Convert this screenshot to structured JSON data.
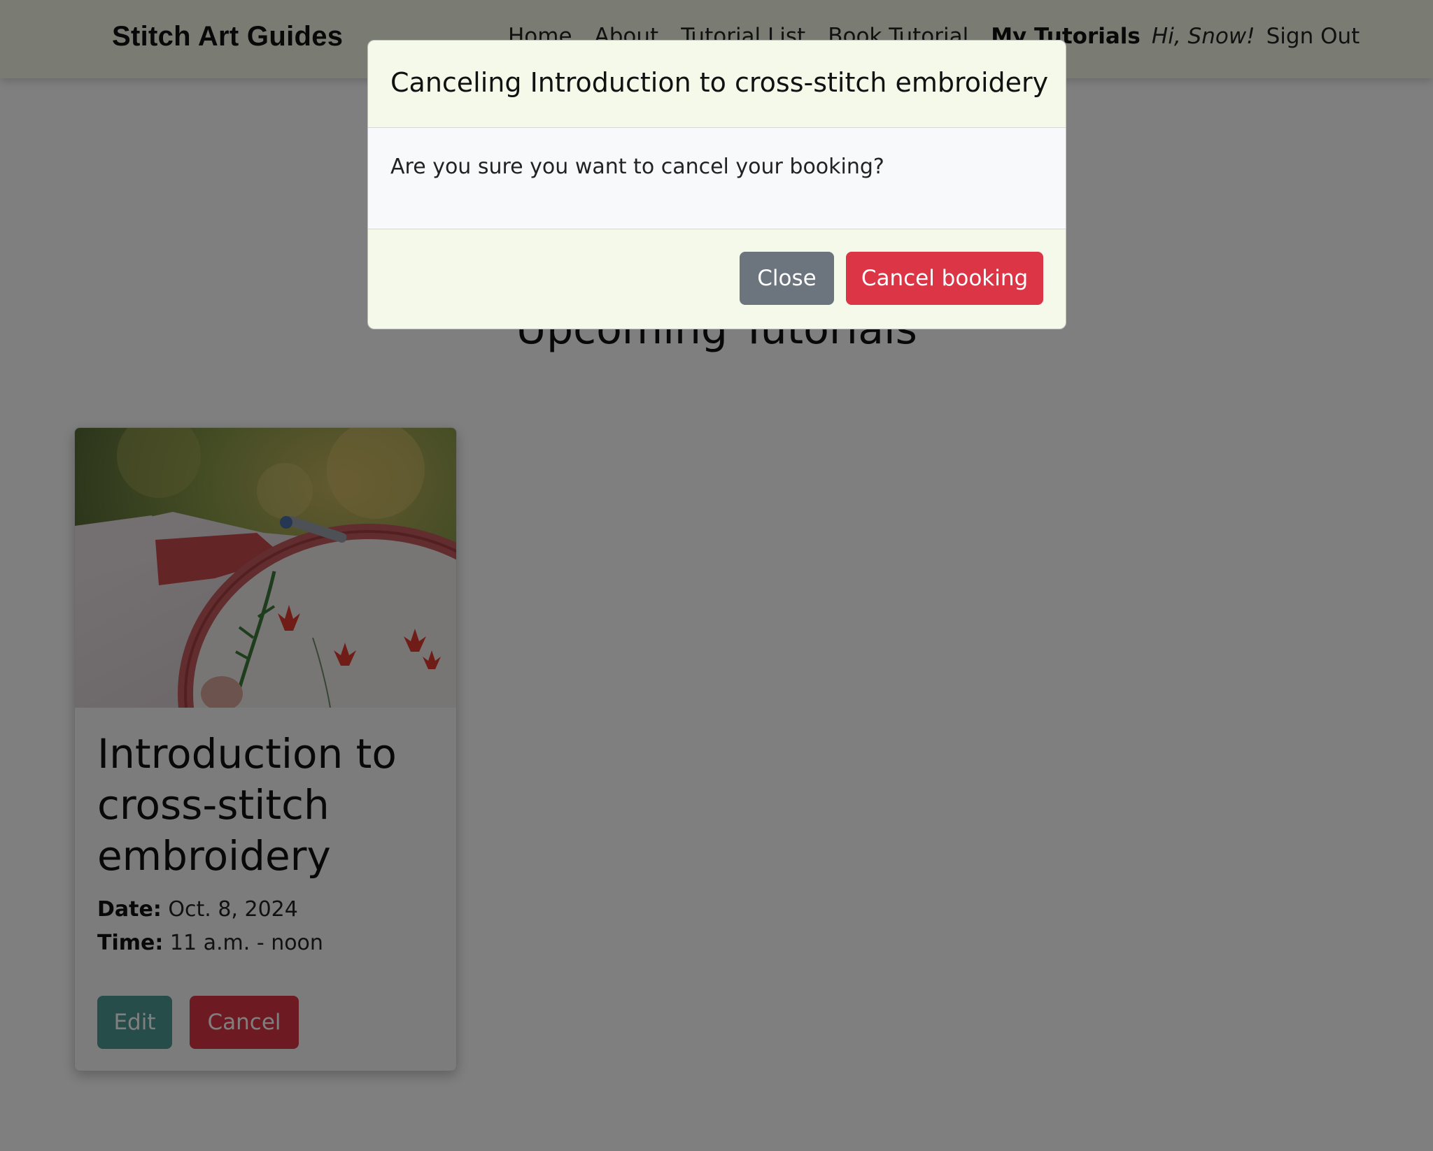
{
  "navbar": {
    "brand": "Stitch Art Guides",
    "links": [
      "Home",
      "About",
      "Tutorial List",
      "Book Tutorial"
    ],
    "active_link": "My Tutorials",
    "greeting": "Hi, Snow!",
    "signout": "Sign Out"
  },
  "main": {
    "heading": "Upcoming Tutorials",
    "card": {
      "title": "Introduction to cross-stitch embroidery",
      "date_label": "Date:",
      "date_value": "Oct. 8, 2024",
      "time_label": "Time:",
      "time_value": "11 a.m. - noon",
      "edit_label": "Edit",
      "cancel_label": "Cancel"
    }
  },
  "modal": {
    "title": "Canceling Introduction to cross-stitch embroidery",
    "body": "Are you sure you want to cancel your booking?",
    "close_label": "Close",
    "confirm_label": "Cancel booking"
  },
  "colors": {
    "navbar_bg": "#f5f9e9",
    "edit_button": "#4e9b95",
    "danger": "#dc3545",
    "secondary": "#6c757d"
  }
}
